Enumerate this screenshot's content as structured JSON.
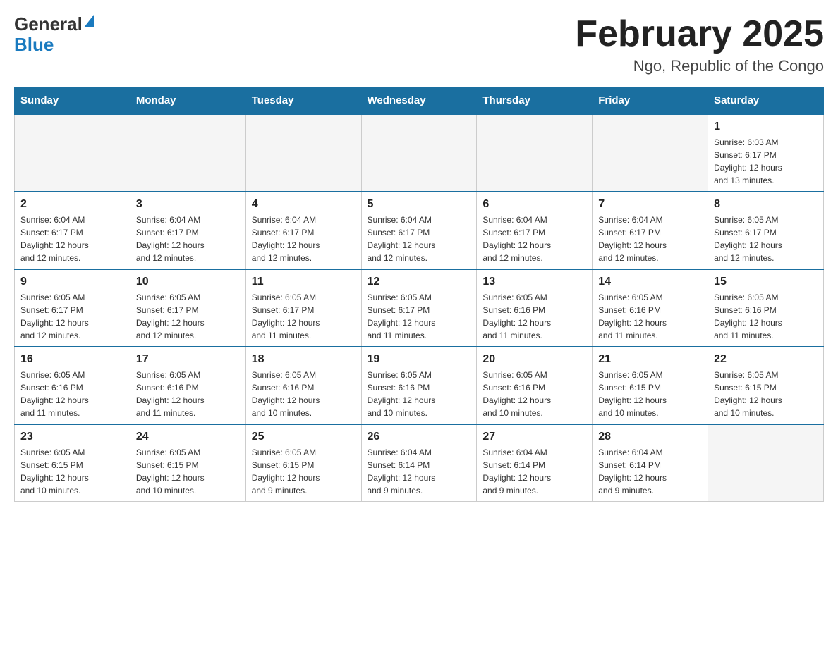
{
  "logo": {
    "text_general": "General",
    "text_blue": "Blue"
  },
  "title": "February 2025",
  "subtitle": "Ngo, Republic of the Congo",
  "days_of_week": [
    "Sunday",
    "Monday",
    "Tuesday",
    "Wednesday",
    "Thursday",
    "Friday",
    "Saturday"
  ],
  "weeks": [
    [
      {
        "day": "",
        "info": "",
        "empty": true
      },
      {
        "day": "",
        "info": "",
        "empty": true
      },
      {
        "day": "",
        "info": "",
        "empty": true
      },
      {
        "day": "",
        "info": "",
        "empty": true
      },
      {
        "day": "",
        "info": "",
        "empty": true
      },
      {
        "day": "",
        "info": "",
        "empty": true
      },
      {
        "day": "1",
        "info": "Sunrise: 6:03 AM\nSunset: 6:17 PM\nDaylight: 12 hours\nand 13 minutes.",
        "empty": false
      }
    ],
    [
      {
        "day": "2",
        "info": "Sunrise: 6:04 AM\nSunset: 6:17 PM\nDaylight: 12 hours\nand 12 minutes.",
        "empty": false
      },
      {
        "day": "3",
        "info": "Sunrise: 6:04 AM\nSunset: 6:17 PM\nDaylight: 12 hours\nand 12 minutes.",
        "empty": false
      },
      {
        "day": "4",
        "info": "Sunrise: 6:04 AM\nSunset: 6:17 PM\nDaylight: 12 hours\nand 12 minutes.",
        "empty": false
      },
      {
        "day": "5",
        "info": "Sunrise: 6:04 AM\nSunset: 6:17 PM\nDaylight: 12 hours\nand 12 minutes.",
        "empty": false
      },
      {
        "day": "6",
        "info": "Sunrise: 6:04 AM\nSunset: 6:17 PM\nDaylight: 12 hours\nand 12 minutes.",
        "empty": false
      },
      {
        "day": "7",
        "info": "Sunrise: 6:04 AM\nSunset: 6:17 PM\nDaylight: 12 hours\nand 12 minutes.",
        "empty": false
      },
      {
        "day": "8",
        "info": "Sunrise: 6:05 AM\nSunset: 6:17 PM\nDaylight: 12 hours\nand 12 minutes.",
        "empty": false
      }
    ],
    [
      {
        "day": "9",
        "info": "Sunrise: 6:05 AM\nSunset: 6:17 PM\nDaylight: 12 hours\nand 12 minutes.",
        "empty": false
      },
      {
        "day": "10",
        "info": "Sunrise: 6:05 AM\nSunset: 6:17 PM\nDaylight: 12 hours\nand 12 minutes.",
        "empty": false
      },
      {
        "day": "11",
        "info": "Sunrise: 6:05 AM\nSunset: 6:17 PM\nDaylight: 12 hours\nand 11 minutes.",
        "empty": false
      },
      {
        "day": "12",
        "info": "Sunrise: 6:05 AM\nSunset: 6:17 PM\nDaylight: 12 hours\nand 11 minutes.",
        "empty": false
      },
      {
        "day": "13",
        "info": "Sunrise: 6:05 AM\nSunset: 6:16 PM\nDaylight: 12 hours\nand 11 minutes.",
        "empty": false
      },
      {
        "day": "14",
        "info": "Sunrise: 6:05 AM\nSunset: 6:16 PM\nDaylight: 12 hours\nand 11 minutes.",
        "empty": false
      },
      {
        "day": "15",
        "info": "Sunrise: 6:05 AM\nSunset: 6:16 PM\nDaylight: 12 hours\nand 11 minutes.",
        "empty": false
      }
    ],
    [
      {
        "day": "16",
        "info": "Sunrise: 6:05 AM\nSunset: 6:16 PM\nDaylight: 12 hours\nand 11 minutes.",
        "empty": false
      },
      {
        "day": "17",
        "info": "Sunrise: 6:05 AM\nSunset: 6:16 PM\nDaylight: 12 hours\nand 11 minutes.",
        "empty": false
      },
      {
        "day": "18",
        "info": "Sunrise: 6:05 AM\nSunset: 6:16 PM\nDaylight: 12 hours\nand 10 minutes.",
        "empty": false
      },
      {
        "day": "19",
        "info": "Sunrise: 6:05 AM\nSunset: 6:16 PM\nDaylight: 12 hours\nand 10 minutes.",
        "empty": false
      },
      {
        "day": "20",
        "info": "Sunrise: 6:05 AM\nSunset: 6:16 PM\nDaylight: 12 hours\nand 10 minutes.",
        "empty": false
      },
      {
        "day": "21",
        "info": "Sunrise: 6:05 AM\nSunset: 6:15 PM\nDaylight: 12 hours\nand 10 minutes.",
        "empty": false
      },
      {
        "day": "22",
        "info": "Sunrise: 6:05 AM\nSunset: 6:15 PM\nDaylight: 12 hours\nand 10 minutes.",
        "empty": false
      }
    ],
    [
      {
        "day": "23",
        "info": "Sunrise: 6:05 AM\nSunset: 6:15 PM\nDaylight: 12 hours\nand 10 minutes.",
        "empty": false
      },
      {
        "day": "24",
        "info": "Sunrise: 6:05 AM\nSunset: 6:15 PM\nDaylight: 12 hours\nand 10 minutes.",
        "empty": false
      },
      {
        "day": "25",
        "info": "Sunrise: 6:05 AM\nSunset: 6:15 PM\nDaylight: 12 hours\nand 9 minutes.",
        "empty": false
      },
      {
        "day": "26",
        "info": "Sunrise: 6:04 AM\nSunset: 6:14 PM\nDaylight: 12 hours\nand 9 minutes.",
        "empty": false
      },
      {
        "day": "27",
        "info": "Sunrise: 6:04 AM\nSunset: 6:14 PM\nDaylight: 12 hours\nand 9 minutes.",
        "empty": false
      },
      {
        "day": "28",
        "info": "Sunrise: 6:04 AM\nSunset: 6:14 PM\nDaylight: 12 hours\nand 9 minutes.",
        "empty": false
      },
      {
        "day": "",
        "info": "",
        "empty": true
      }
    ]
  ]
}
